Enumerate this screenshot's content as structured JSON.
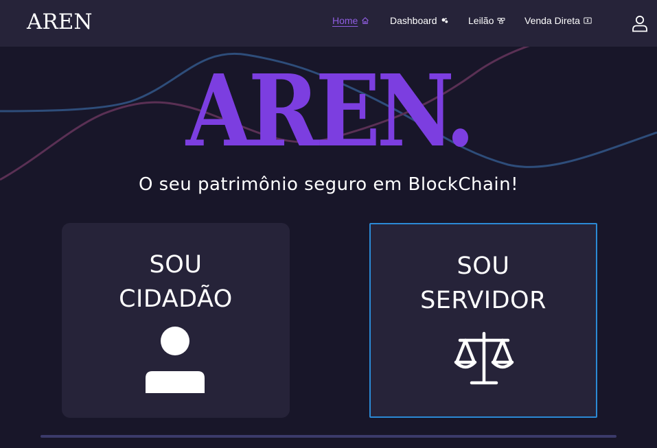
{
  "header": {
    "logo": "AREN",
    "nav": [
      {
        "label": "Home",
        "icon": "home-icon",
        "active": true
      },
      {
        "label": "Dashboard",
        "icon": "dashboard-icon",
        "active": false
      },
      {
        "label": "Leilão",
        "icon": "auction-icon",
        "active": false
      },
      {
        "label": "Venda Direta",
        "icon": "direct-sale-icon",
        "active": false
      }
    ],
    "user_icon": "user-icon"
  },
  "hero": {
    "title": "AREN.",
    "subtitle": "O seu patrimônio seguro em BlockChain!"
  },
  "cards": [
    {
      "title_line1": "SOU",
      "title_line2": "CIDADÃO",
      "icon": "person-icon"
    },
    {
      "title_line1": "SOU",
      "title_line2": "SERVIDOR",
      "icon": "scales-icon",
      "selected": true
    }
  ],
  "colors": {
    "background": "#181629",
    "header": "#262339",
    "card": "#262339",
    "accent": "#7c3ee0",
    "nav_active": "#8f5de0",
    "selected_border": "#2b8ad6",
    "line_blue": "#2e4d7a",
    "line_purple": "#5a3054"
  }
}
